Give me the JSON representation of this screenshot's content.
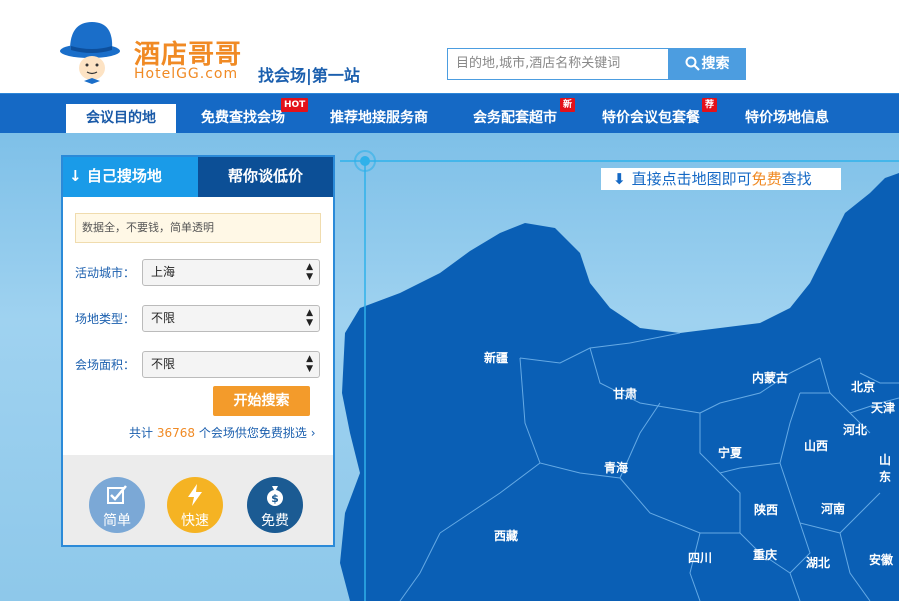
{
  "logo": {
    "name_cn": "酒店哥哥",
    "name_en": "HotelGG.com",
    "slogan": "找会场|第一站"
  },
  "search": {
    "placeholder": "目的地,城市,酒店名称关键词",
    "button_label": "搜索"
  },
  "nav": {
    "items": [
      {
        "label": "会议目的地",
        "active": true
      },
      {
        "label": "免费查找会场",
        "badge": "HOT"
      },
      {
        "label": "推荐地接服务商"
      },
      {
        "label": "会务配套超市",
        "badge": "新"
      },
      {
        "label": "特价会议包套餐",
        "badge": "荐"
      },
      {
        "label": "特价场地信息"
      }
    ]
  },
  "panel": {
    "tab_self": "自己搜场地",
    "tab_help": "帮你谈低价",
    "notice": "数据全，不要钱，简单透明",
    "city_label": "活动城市：",
    "city_value": "上海",
    "type_label": "场地类型：",
    "type_value": "不限",
    "area_label": "会场面积：",
    "area_value": "不限",
    "start_button": "开始搜索",
    "count_prefix": "共计",
    "count_value": "36768",
    "count_suffix": "个会场供您免费挑选",
    "features": [
      "简单",
      "快速",
      "免费"
    ]
  },
  "map": {
    "banner_prefix": "直接点击地图即可",
    "banner_free": "免费",
    "banner_suffix": "查找",
    "provinces": [
      "新疆",
      "甘肃",
      "内蒙古",
      "北京",
      "天津",
      "河北",
      "宁夏",
      "山西",
      "山东",
      "青海",
      "陕西",
      "河南",
      "西藏",
      "四川",
      "重庆",
      "湖北",
      "安徽"
    ]
  },
  "colors": {
    "brand_orange": "#f08a24",
    "nav_blue": "#1569c5",
    "map_land": "#0a5fb5",
    "map_sea": "#8ec8ea"
  }
}
